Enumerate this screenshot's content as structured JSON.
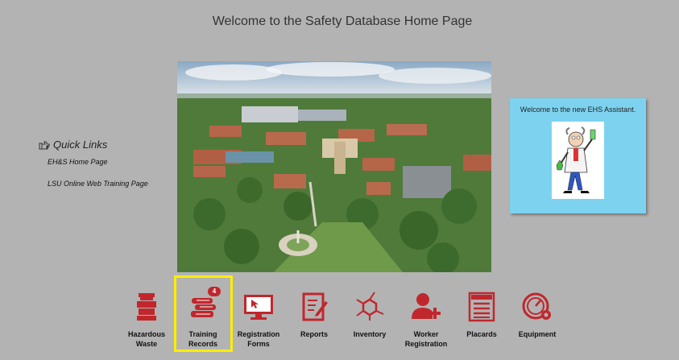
{
  "page": {
    "title": "Welcome to the Safety Database Home Page"
  },
  "quick_links": {
    "heading": "Quick Links",
    "heading_icon": "pointing-hand-icon",
    "items": [
      {
        "label": "EH&S Home Page"
      },
      {
        "label": "LSU Online Web Training Page"
      }
    ]
  },
  "assistant": {
    "text": "Welcome to the new EHS Assistant."
  },
  "nav": {
    "accent_color": "#c0272d",
    "highlight_color": "#ffee00",
    "items": [
      {
        "label_line1": "Hazardous",
        "label_line2": "Waste",
        "icon": "waste-barrel-icon"
      },
      {
        "label_line1": "Training",
        "label_line2": "Records",
        "icon": "books-icon",
        "badge": "4"
      },
      {
        "label_line1": "Registration",
        "label_line2": "Forms",
        "icon": "monitor-cursor-icon"
      },
      {
        "label_line1": "Reports",
        "label_line2": "",
        "icon": "report-pen-icon"
      },
      {
        "label_line1": "Inventory",
        "label_line2": "",
        "icon": "molecule-icon"
      },
      {
        "label_line1": "Worker",
        "label_line2": "Registration",
        "icon": "add-user-icon"
      },
      {
        "label_line1": "Placards",
        "label_line2": "",
        "icon": "caution-placard-icon"
      },
      {
        "label_line1": "Equipment",
        "label_line2": "",
        "icon": "gauge-gear-icon"
      }
    ]
  }
}
